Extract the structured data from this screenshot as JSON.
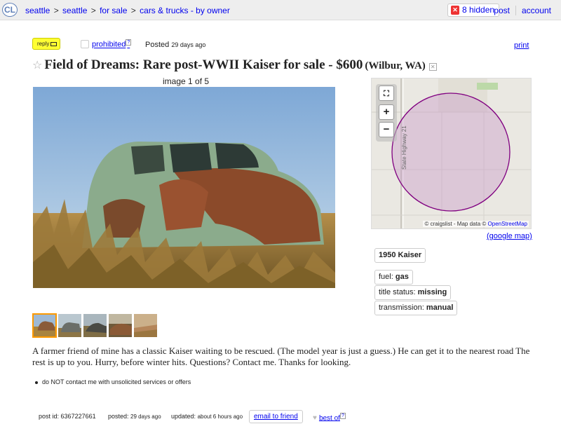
{
  "header": {
    "logo": "CL",
    "breadcrumbs": [
      "seattle",
      "seattle",
      "for sale",
      "cars & trucks - by owner"
    ],
    "hidden_label": "8 hidden",
    "links": [
      "post",
      "account"
    ]
  },
  "actions": {
    "reply_label": "reply",
    "prohibited_label": "prohibited",
    "prohibited_sup": "?",
    "posted_label": "Posted",
    "posted_time": "29 days ago",
    "print_label": "print"
  },
  "listing": {
    "title": "Field of Dreams: Rare post-WWII Kaiser for sale - $600",
    "location": "(Wilbur, WA)"
  },
  "gallery": {
    "counter": "image 1 of 5",
    "thumb_count": 5
  },
  "map": {
    "road_label": "State Highway 21",
    "attribution_prefix": "© craigslist - Map data ©",
    "attribution_link": "OpenStreetMap",
    "google_link": "(google map)",
    "controls": [
      "expand",
      "+",
      "−"
    ]
  },
  "attributes": {
    "model": "1950 Kaiser",
    "fuel_label": "fuel:",
    "fuel_value": "gas",
    "title_label": "title status:",
    "title_value": "missing",
    "transmission_label": "transmission:",
    "transmission_value": "manual"
  },
  "body": {
    "text": "A farmer friend of mine has a classic Kaiser waiting to be rescued. (The model year is just a guess.) He can get it to the nearest road The rest is up to you. Hurry, before winter hits. Questions? Contact me. Thanks for looking.",
    "notice": "do NOT contact me with unsolicited services or offers"
  },
  "footer": {
    "post_id_label": "post id:",
    "post_id": "6367227661",
    "posted_label": "posted:",
    "posted_time": "29 days ago",
    "updated_label": "updated:",
    "updated_time": "about 6 hours ago",
    "email_label": "email to friend",
    "bestof_label": "best of",
    "bestof_sup": "?"
  },
  "colors": {
    "link": "#0000ee",
    "reply_bg": "#ffff33",
    "map_circle": "#800080",
    "thumb_selected": "#ff9900"
  }
}
